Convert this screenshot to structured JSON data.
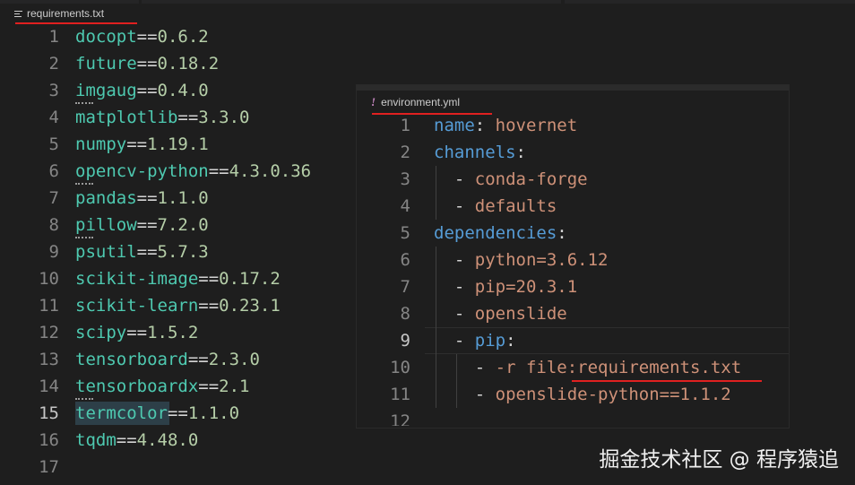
{
  "editor_main": {
    "tab_title": "requirements.txt",
    "tab_icon": "lines-file-icon",
    "active_line": 15,
    "lines": [
      {
        "num": "1",
        "pkg": "docopt",
        "op": "==",
        "ver": "0.6.2"
      },
      {
        "num": "2",
        "pkg": "future",
        "op": "==",
        "ver": "0.18.2"
      },
      {
        "num": "3",
        "pkg": "imgaug",
        "op": "==",
        "ver": "0.4.0"
      },
      {
        "num": "4",
        "pkg": "matplotlib",
        "op": "==",
        "ver": "3.3.0"
      },
      {
        "num": "5",
        "pkg": "numpy",
        "op": "==",
        "ver": "1.19.1"
      },
      {
        "num": "6",
        "pkg": "opencv-python",
        "op": "==",
        "ver": "4.3.0.36"
      },
      {
        "num": "7",
        "pkg": "pandas",
        "op": "==",
        "ver": "1.1.0"
      },
      {
        "num": "8",
        "pkg": "pillow",
        "op": "==",
        "ver": "7.2.0"
      },
      {
        "num": "9",
        "pkg": "psutil",
        "op": "==",
        "ver": "5.7.3"
      },
      {
        "num": "10",
        "pkg": "scikit-image",
        "op": "==",
        "ver": "0.17.2"
      },
      {
        "num": "11",
        "pkg": "scikit-learn",
        "op": "==",
        "ver": "0.23.1"
      },
      {
        "num": "12",
        "pkg": "scipy",
        "op": "==",
        "ver": "1.5.2"
      },
      {
        "num": "13",
        "pkg": "tensorboard",
        "op": "==",
        "ver": "2.3.0"
      },
      {
        "num": "14",
        "pkg": "tensorboardx",
        "op": "==",
        "ver": "2.1"
      },
      {
        "num": "15",
        "pkg": "termcolor",
        "op": "==",
        "ver": "1.1.0"
      },
      {
        "num": "16",
        "pkg": "tqdm",
        "op": "==",
        "ver": "4.48.0"
      },
      {
        "num": "17",
        "pkg": "",
        "op": "",
        "ver": ""
      }
    ]
  },
  "editor_popup": {
    "tab_title": "environment.yml",
    "tab_icon_glyph": "!",
    "active_line": 9,
    "lines": [
      {
        "num": "1",
        "tokens": [
          [
            "key",
            "name"
          ],
          [
            "punct",
            ": "
          ],
          [
            "str",
            "hovernet"
          ]
        ]
      },
      {
        "num": "2",
        "tokens": [
          [
            "key",
            "channels"
          ],
          [
            "punct",
            ":"
          ]
        ]
      },
      {
        "num": "3",
        "tokens": [
          [
            "punct",
            "  - "
          ],
          [
            "str",
            "conda-forge"
          ]
        ]
      },
      {
        "num": "4",
        "tokens": [
          [
            "punct",
            "  - "
          ],
          [
            "str",
            "defaults"
          ]
        ]
      },
      {
        "num": "5",
        "tokens": [
          [
            "key",
            "dependencies"
          ],
          [
            "punct",
            ":"
          ]
        ]
      },
      {
        "num": "6",
        "tokens": [
          [
            "punct",
            "  - "
          ],
          [
            "str",
            "python=3.6.12"
          ]
        ]
      },
      {
        "num": "7",
        "tokens": [
          [
            "punct",
            "  - "
          ],
          [
            "str",
            "pip=20.3.1"
          ]
        ]
      },
      {
        "num": "8",
        "tokens": [
          [
            "punct",
            "  - "
          ],
          [
            "str",
            "openslide"
          ]
        ]
      },
      {
        "num": "9",
        "tokens": [
          [
            "punct",
            "  - "
          ],
          [
            "key",
            "pip"
          ],
          [
            "punct",
            ":"
          ]
        ]
      },
      {
        "num": "10",
        "tokens": [
          [
            "punct",
            "    - "
          ],
          [
            "str",
            "-r file:requirements.txt"
          ]
        ]
      },
      {
        "num": "11",
        "tokens": [
          [
            "punct",
            "    - "
          ],
          [
            "str",
            "openslide-python==1.1.2"
          ]
        ]
      },
      {
        "num": "12",
        "tokens": []
      }
    ]
  },
  "watermark": "掘金技术社区 @ 程序猿追",
  "colors": {
    "background": "#1e1e1e",
    "package": "#4ec9b0",
    "version": "#b5cea8",
    "yaml_key": "#569cd6",
    "yaml_string": "#ce9178",
    "annotation_underline": "#e02020"
  }
}
